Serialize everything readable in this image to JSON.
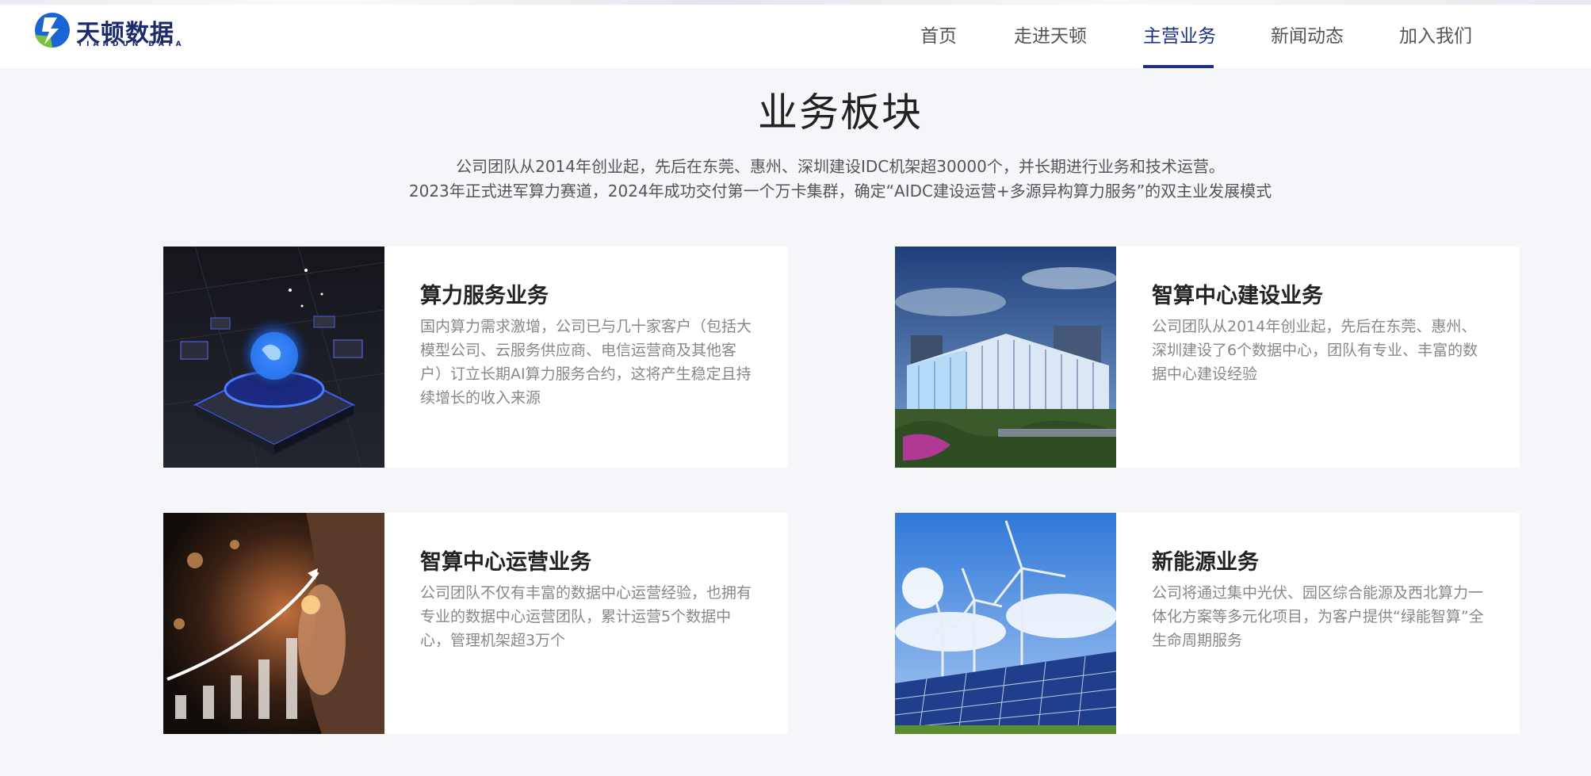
{
  "brand": {
    "name_cn": "天顿数据",
    "name_en": "TIANDUN DATA",
    "colors": {
      "primary": "#1c2e86",
      "logo_green": "#7ac143",
      "logo_blue": "#1a64d6"
    }
  },
  "nav": {
    "items": [
      {
        "label": "首页",
        "active": false
      },
      {
        "label": "走进天顿",
        "active": false
      },
      {
        "label": "主营业务",
        "active": true
      },
      {
        "label": "新闻动态",
        "active": false
      },
      {
        "label": "加入我们",
        "active": false
      }
    ]
  },
  "section": {
    "title": "业务板块",
    "intro_line1": "公司团队从2014年创业起，先后在东莞、惠州、深圳建设IDC机架超30000个，并长期进行业务和技术运营。",
    "intro_line2": "2023年正式进军算力赛道，2024年成功交付第一个万卡集群，确定“AIDC建设运营+多源异构算力服务”的双主业发展模式"
  },
  "cards": [
    {
      "title": "算力服务业务",
      "desc": "国内算力需求激增，公司已与几十家客户（包括大模型公司、云服务供应商、电信运营商及其他客户）订立长期AI算力服务合约，这将产生稳定且持续增长的收入来源",
      "image": "globe-server-image"
    },
    {
      "title": "智算中心建设业务",
      "desc": "公司团队从2014年创业起，先后在东莞、惠州、深圳建设了6个数据中心，团队有专业、丰富的数据中心建设经验",
      "image": "datacenter-building-image"
    },
    {
      "title": "智算中心运营业务",
      "desc": "公司团队不仅有丰富的数据中心运营经验，也拥有专业的数据中心运营团队，累计运营5个数据中心，管理机架超3万个",
      "image": "growth-chart-image"
    },
    {
      "title": "新能源业务",
      "desc": "公司将通过集中光伏、园区综合能源及西北算力一体化方案等多元化项目，为客户提供“绿能智算”全生命周期服务",
      "image": "wind-solar-image"
    }
  ]
}
